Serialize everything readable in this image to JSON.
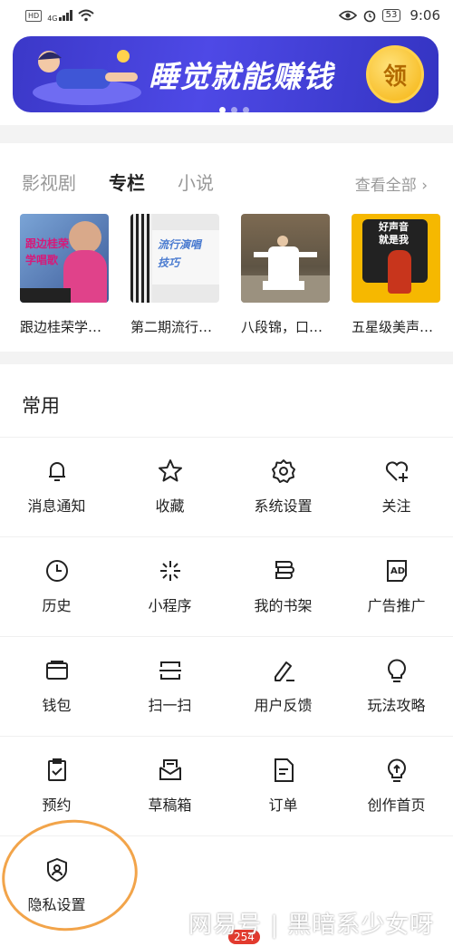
{
  "status_bar": {
    "tag": "HD",
    "network": "4G",
    "battery": "53",
    "time": "9:06"
  },
  "banner": {
    "text": "睡觉就能赚钱",
    "coin_label": "领"
  },
  "content": {
    "tabs": [
      {
        "label": "影视剧",
        "active": false
      },
      {
        "label": "专栏",
        "active": true
      },
      {
        "label": "小说",
        "active": false
      }
    ],
    "view_all": "查看全部 ›",
    "cards": [
      {
        "title": "跟边桂荣学…",
        "overlay": "跟边桂荣\n学唱歌"
      },
      {
        "title": "第二期流行…",
        "overlay": "流行演唱\n技巧"
      },
      {
        "title": "八段锦，口…",
        "overlay": ""
      },
      {
        "title": "五星级美声…",
        "overlay": "好声音\n就是我"
      }
    ]
  },
  "common": {
    "title": "常用",
    "items": [
      {
        "label": "消息通知",
        "icon": "bell-icon"
      },
      {
        "label": "收藏",
        "icon": "star-icon"
      },
      {
        "label": "系统设置",
        "icon": "gear-icon"
      },
      {
        "label": "关注",
        "icon": "heart-plus-icon"
      },
      {
        "label": "历史",
        "icon": "clock-icon"
      },
      {
        "label": "小程序",
        "icon": "mini-program-icon"
      },
      {
        "label": "我的书架",
        "icon": "bookshelf-icon"
      },
      {
        "label": "广告推广",
        "icon": "ad-icon"
      },
      {
        "label": "钱包",
        "icon": "wallet-icon"
      },
      {
        "label": "扫一扫",
        "icon": "scan-icon"
      },
      {
        "label": "用户反馈",
        "icon": "feedback-icon"
      },
      {
        "label": "玩法攻略",
        "icon": "lightbulb-icon"
      },
      {
        "label": "预约",
        "icon": "clipboard-check-icon"
      },
      {
        "label": "草稿箱",
        "icon": "drafts-icon"
      },
      {
        "label": "订单",
        "icon": "order-icon"
      },
      {
        "label": "创作首页",
        "icon": "creator-icon"
      }
    ],
    "privacy": {
      "label": "隐私设置",
      "icon": "shield-user-icon"
    }
  },
  "watermark": "网易号 | 黑暗系少女呀",
  "nav_badge": "254",
  "colors": {
    "banner": "#4e49e6",
    "coin": "#f5b30f",
    "annotation": "#f2a44a",
    "badge": "#e23a2e"
  }
}
